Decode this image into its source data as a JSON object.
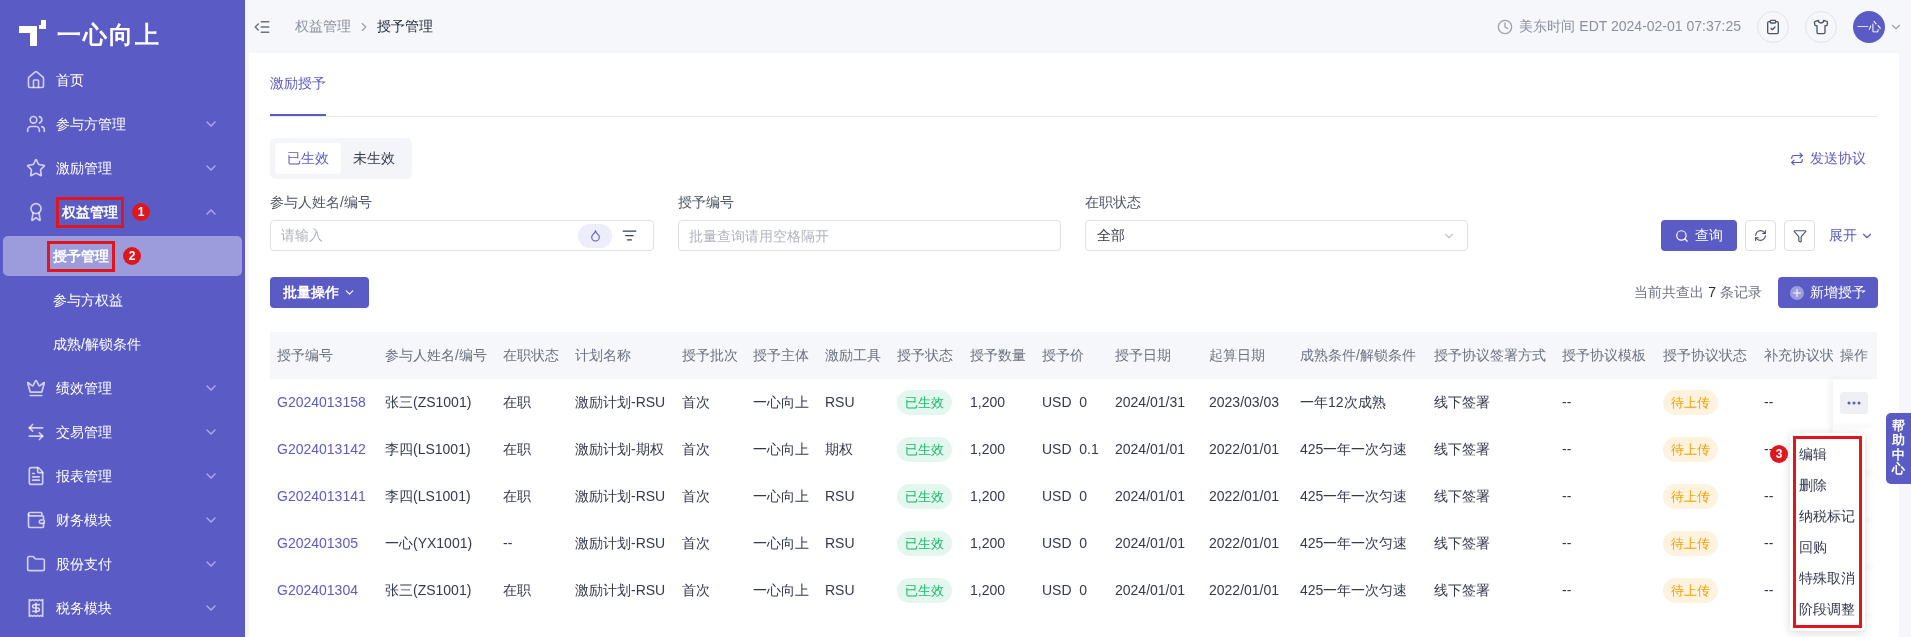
{
  "logo": {
    "text": "一心向上"
  },
  "sidebar": {
    "items": [
      {
        "label": "首页"
      },
      {
        "label": "参与方管理",
        "expanded": false
      },
      {
        "label": "激励管理",
        "expanded": false
      },
      {
        "label": "权益管理",
        "expanded": true,
        "annotation": "1",
        "children": [
          {
            "label": "授予管理",
            "selected": true,
            "annotation": "2"
          },
          {
            "label": "参与方权益",
            "selected": false
          },
          {
            "label": "成熟/解锁条件",
            "selected": false
          }
        ]
      },
      {
        "label": "绩效管理",
        "expanded": false
      },
      {
        "label": "交易管理",
        "expanded": false
      },
      {
        "label": "报表管理",
        "expanded": false
      },
      {
        "label": "财务模块",
        "expanded": false
      },
      {
        "label": "股份支付",
        "expanded": false
      },
      {
        "label": "税务模块",
        "expanded": false
      }
    ]
  },
  "topbar": {
    "breadcrumb": [
      "权益管理",
      "授予管理"
    ],
    "time": "美东时间 EDT 2024-02-01 07:37:25",
    "avatar": "一心"
  },
  "page_tabs": [
    {
      "label": "激励授予",
      "selected": true
    }
  ],
  "status_toggle": [
    {
      "label": "已生效",
      "selected": true
    },
    {
      "label": "未生效",
      "selected": false
    }
  ],
  "send_agreement": "发送协议",
  "filters": [
    {
      "kind": "input",
      "label": "参与人姓名/编号",
      "placeholder": "请输入"
    },
    {
      "kind": "plain",
      "label": "授予编号",
      "placeholder": "批量查询请用空格隔开"
    },
    {
      "kind": "select",
      "label": "在职状态",
      "value": "全部"
    }
  ],
  "query_button": "查询",
  "expand_link": "展开",
  "batch_button": "批量操作",
  "record_count": {
    "before": "当前共查出",
    "count": "7",
    "after": "条记录"
  },
  "add_button": "新增授予",
  "table": {
    "columns": [
      {
        "label": "授予编号",
        "kind": "link"
      },
      {
        "label": "参与人姓名/编号",
        "kind": "text"
      },
      {
        "label": "在职状态",
        "kind": "text"
      },
      {
        "label": "计划名称",
        "kind": "text"
      },
      {
        "label": "授予批次",
        "kind": "text"
      },
      {
        "label": "授予主体",
        "kind": "text"
      },
      {
        "label": "激励工具",
        "kind": "text"
      },
      {
        "label": "授予状态",
        "kind": "green_tag"
      },
      {
        "label": "授予数量",
        "kind": "text"
      },
      {
        "label": "授予价",
        "kind": "text"
      },
      {
        "label": "授予日期",
        "kind": "text"
      },
      {
        "label": "起算日期",
        "kind": "text"
      },
      {
        "label": "成熟条件/解锁条件",
        "kind": "text"
      },
      {
        "label": "授予协议签署方式",
        "kind": "text"
      },
      {
        "label": "授予协议模板",
        "kind": "text"
      },
      {
        "label": "授予协议状态",
        "kind": "orange_tag"
      },
      {
        "label": "补充协议状",
        "kind": "text"
      },
      {
        "label": "操作",
        "kind": "action"
      }
    ],
    "rows": [
      {
        "menu_open": true,
        "cells": [
          "G2024013158",
          "张三(ZS1001)",
          "在职",
          "激励计划-RSU",
          "首次",
          "一心向上",
          "RSU",
          "已生效",
          "1,200",
          "USD  0",
          "2024/01/31",
          "2023/03/03",
          "一年12次成熟",
          "线下签署",
          "--",
          "待上传",
          "--"
        ]
      },
      {
        "menu_open": false,
        "cells": [
          "G2024013142",
          "李四(LS1001)",
          "在职",
          "激励计划-期权",
          "首次",
          "一心向上",
          "期权",
          "已生效",
          "1,200",
          "USD  0.1",
          "2024/01/01",
          "2022/01/01",
          "425一年一次匀速",
          "线下签署",
          "--",
          "待上传",
          "--"
        ]
      },
      {
        "menu_open": false,
        "cells": [
          "G2024013141",
          "李四(LS1001)",
          "在职",
          "激励计划-RSU",
          "首次",
          "一心向上",
          "RSU",
          "已生效",
          "1,200",
          "USD  0",
          "2024/01/01",
          "2022/01/01",
          "425一年一次匀速",
          "线下签署",
          "--",
          "待上传",
          "--"
        ]
      },
      {
        "menu_open": false,
        "cells": [
          "G202401305",
          "一心(YX1001)",
          "--",
          "激励计划-RSU",
          "首次",
          "一心向上",
          "RSU",
          "已生效",
          "1,200",
          "USD  0",
          "2024/01/01",
          "2022/01/01",
          "425一年一次匀速",
          "线下签署",
          "--",
          "待上传",
          "--"
        ]
      },
      {
        "menu_open": false,
        "cells": [
          "G202401304",
          "张三(ZS1001)",
          "在职",
          "激励计划-RSU",
          "首次",
          "一心向上",
          "RSU",
          "已生效",
          "1,200",
          "USD  0",
          "2024/01/01",
          "2022/01/01",
          "425一年一次匀速",
          "线下签署",
          "--",
          "待上传",
          "--"
        ]
      }
    ]
  },
  "row_menu": {
    "annotation": "3",
    "items": [
      "编辑",
      "删除",
      "纳税标记",
      "回购",
      "特殊取消",
      "阶段调整"
    ]
  },
  "help_tab": "帮助中心"
}
